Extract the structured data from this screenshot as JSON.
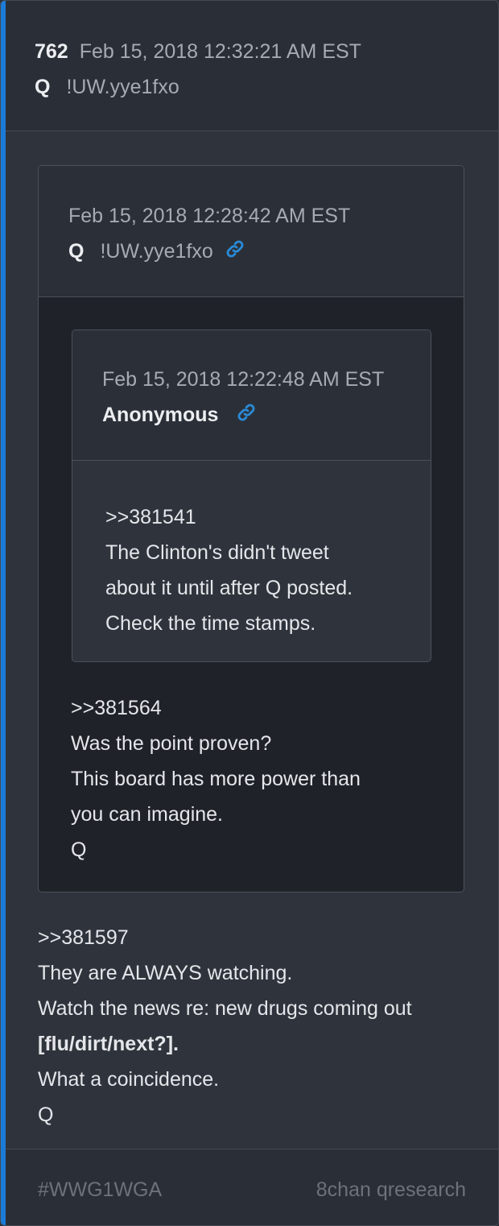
{
  "post": {
    "number": "762",
    "timestamp": "Feb 15, 2018 12:32:21 AM EST",
    "author": "Q",
    "tripcode": "!UW.yye1fxo",
    "body": [
      ">>381597",
      "They are ALWAYS watching.",
      "Watch the news re: new drugs coming out",
      "[flu/dirt/next?].",
      "What a coincidence.",
      "Q"
    ]
  },
  "quote_outer": {
    "timestamp": "Feb 15, 2018 12:28:42 AM EST",
    "author": "Q",
    "tripcode": "!UW.yye1fxo",
    "body": [
      ">>381564",
      "Was the point proven?",
      "This board has more power than",
      "you can imagine.",
      "Q"
    ]
  },
  "quote_inner": {
    "timestamp": "Feb 15, 2018 12:22:48 AM EST",
    "author": "Anonymous",
    "body": [
      ">>381541",
      "The Clinton's didn't tweet",
      "about it until after Q posted.",
      "Check the time stamps."
    ]
  },
  "footer": {
    "tag": "#WWG1WGA",
    "source": "8chan qresearch"
  },
  "colors": {
    "accent": "#1b7bd8",
    "link_icon": "#2a8ad6"
  },
  "icons": {
    "link": "link-icon"
  }
}
